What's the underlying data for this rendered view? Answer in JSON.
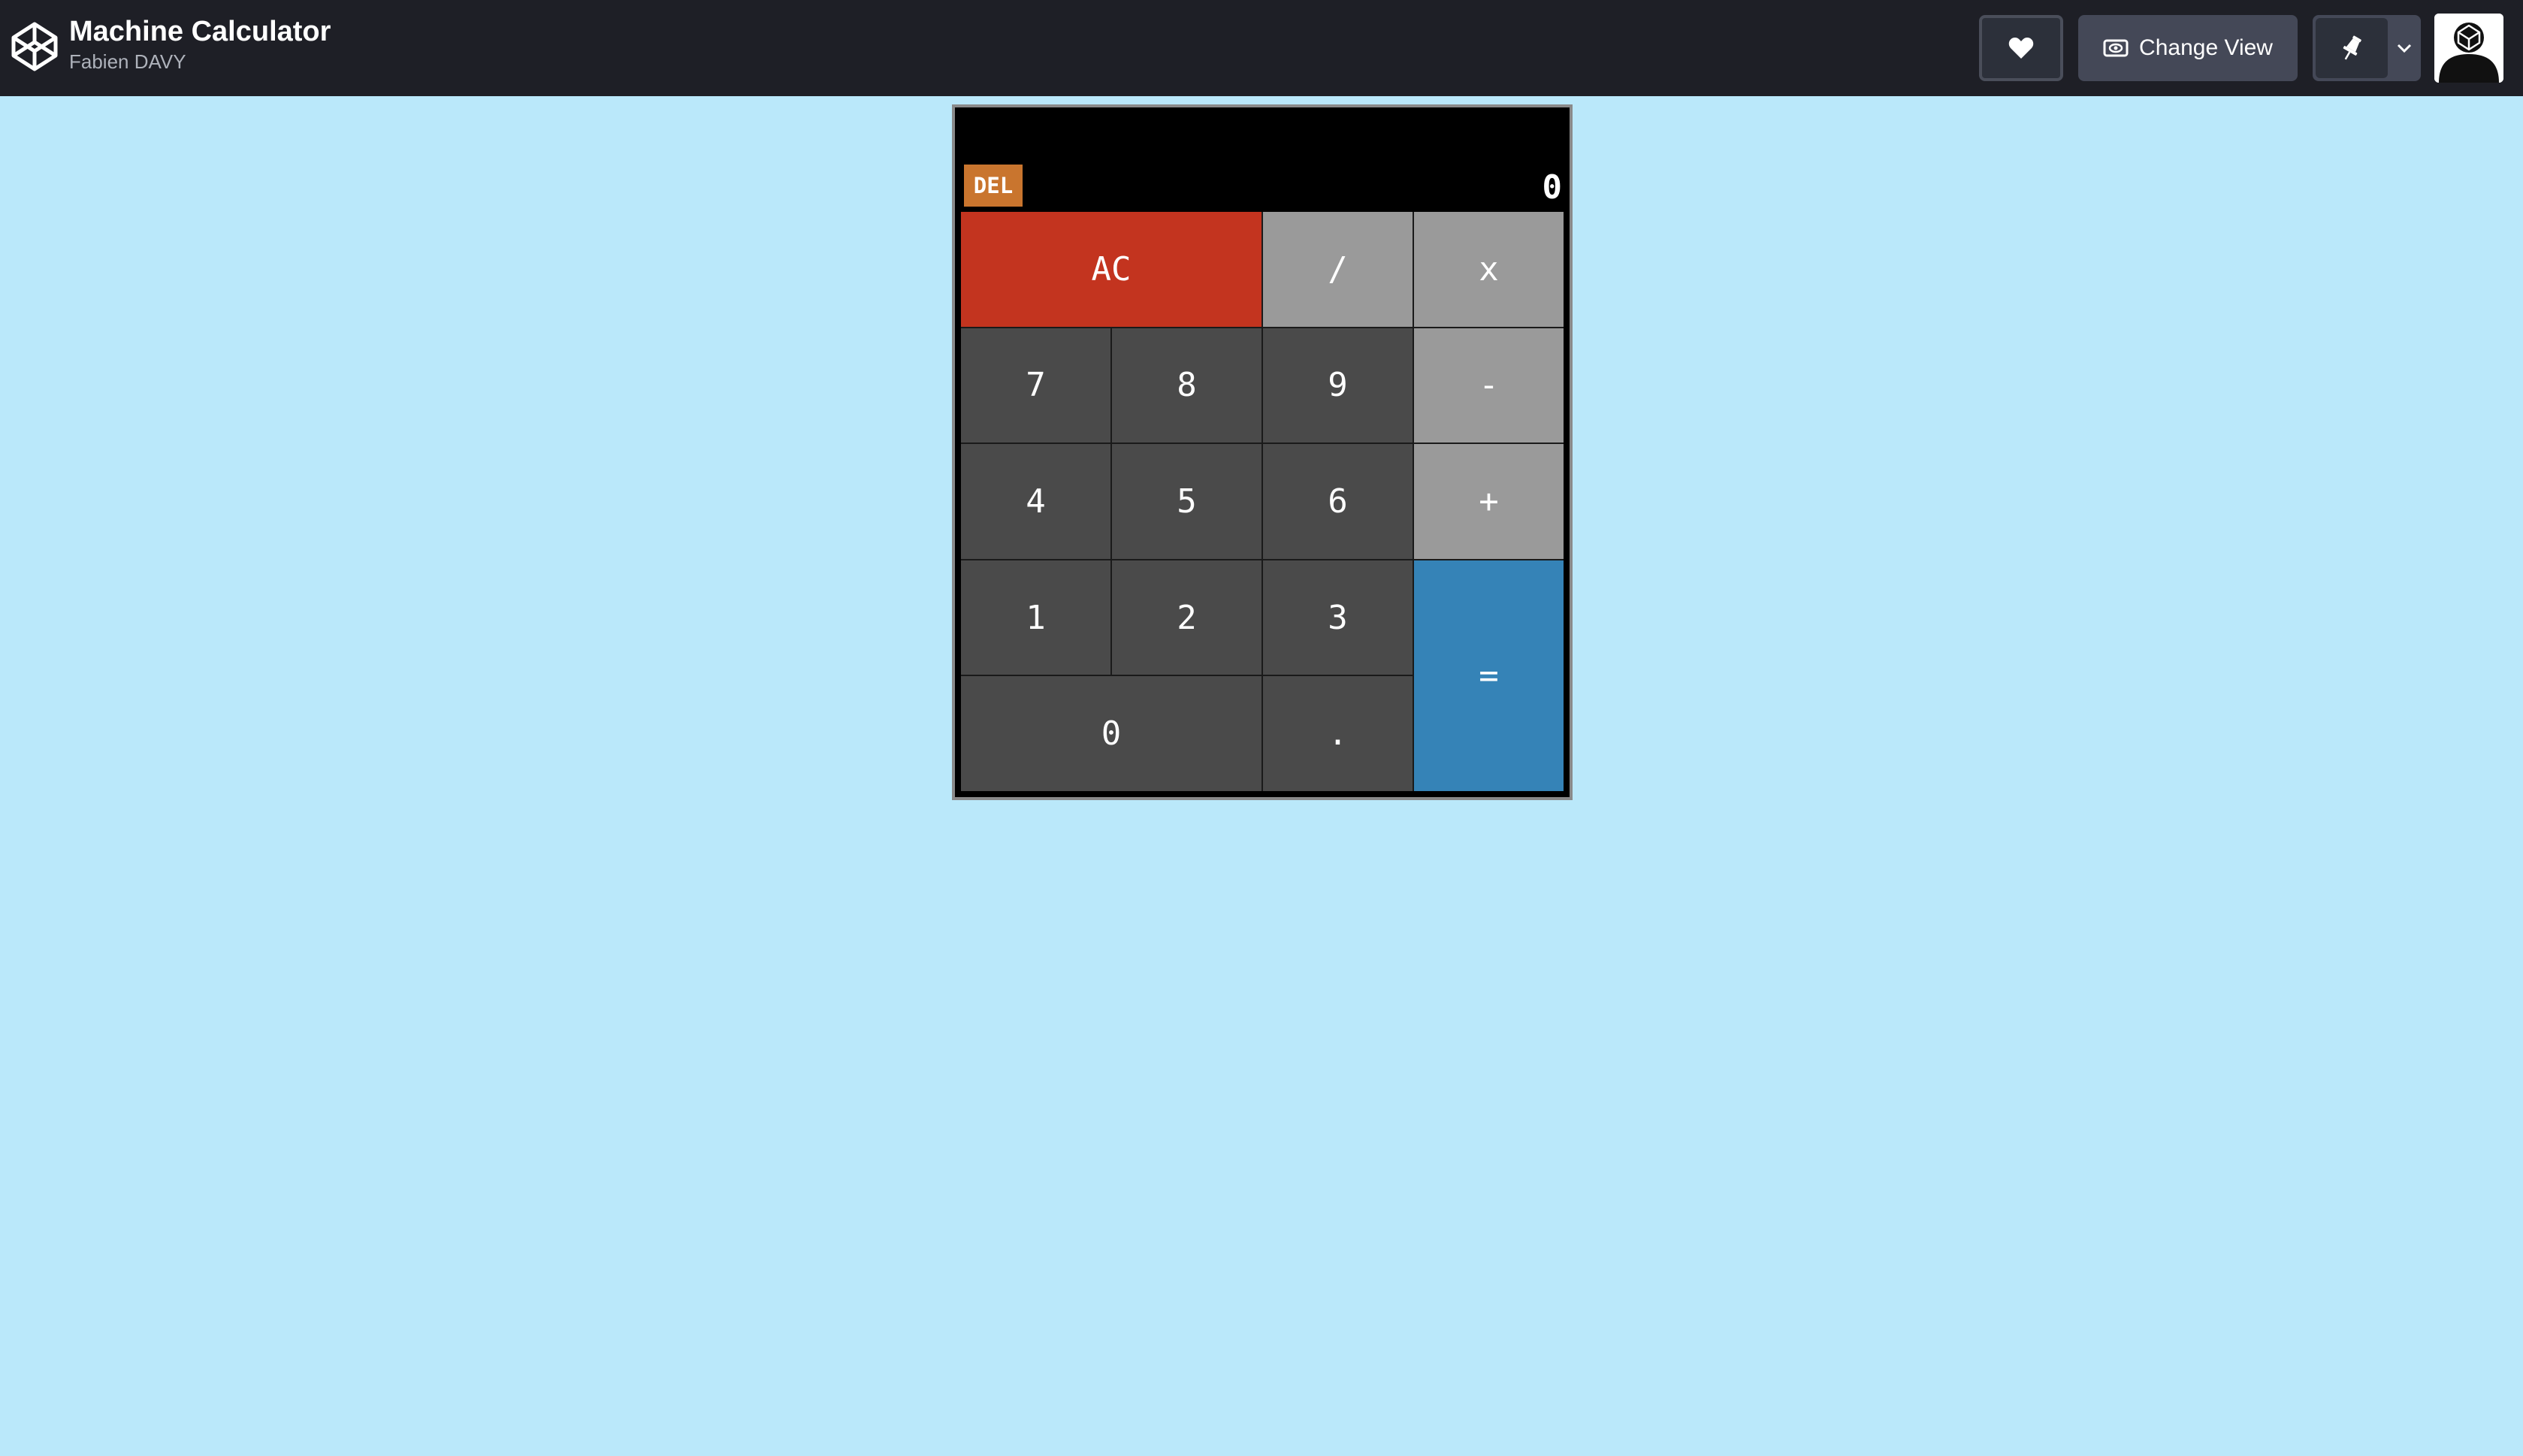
{
  "header": {
    "title": "Machine Calculator",
    "author": "Fabien DAVY",
    "change_view_label": "Change View",
    "icons": {
      "logo": "codepen-logo-icon",
      "like": "heart-icon",
      "view": "eye-icon",
      "pin": "pin-icon",
      "menu": "chevron-down-icon",
      "avatar": "user-avatar"
    }
  },
  "calculator": {
    "display_value": "0",
    "del_label": "DEL",
    "keys": {
      "ac": "AC",
      "divide": "/",
      "multiply": "x",
      "seven": "7",
      "eight": "8",
      "nine": "9",
      "minus": "-",
      "four": "4",
      "five": "5",
      "six": "6",
      "plus": "+",
      "one": "1",
      "two": "2",
      "three": "3",
      "equals": "=",
      "zero": "0",
      "decimal": "."
    },
    "colors": {
      "background": "#bae8fa",
      "number_key": "#4a4a4a",
      "operator_key": "#9a9a9a",
      "clear_key": "#c3341f",
      "equals_key": "#3583b7",
      "delete_key": "#c9752e"
    }
  }
}
